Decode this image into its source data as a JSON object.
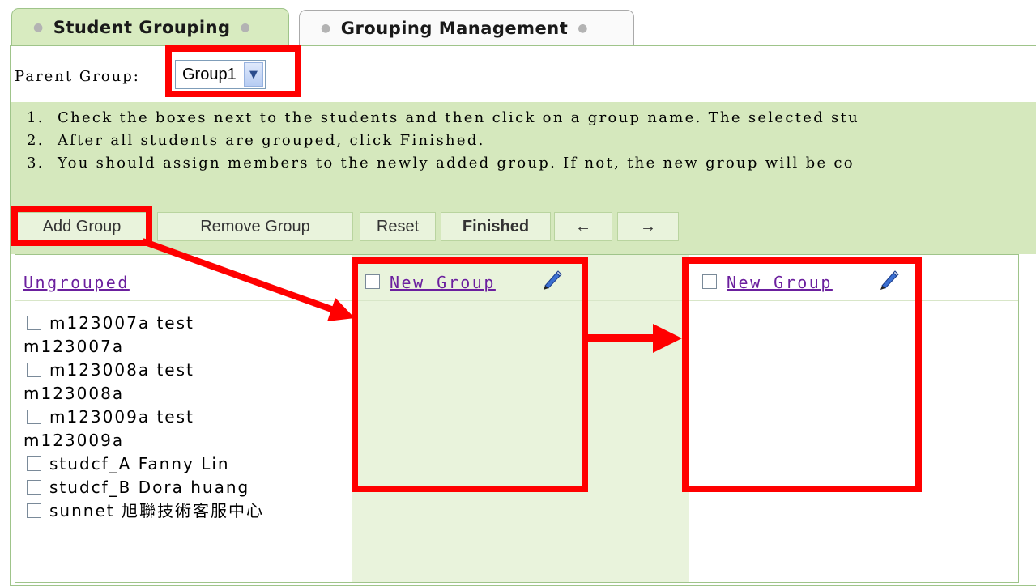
{
  "tabs": [
    {
      "label": "Student Grouping",
      "active": true
    },
    {
      "label": "Grouping Management",
      "active": false
    }
  ],
  "parent_group": {
    "label": "Parent Group:",
    "selected": "Group1"
  },
  "instructions": [
    {
      "num": "1.",
      "text": "Check the boxes next to the students and then click on a group name. The selected stu"
    },
    {
      "num": "2.",
      "text": "After all students are grouped, click Finished."
    },
    {
      "num": "3.",
      "text": "You should assign members to the newly added group. If not, the new group will be co"
    }
  ],
  "toolbar": {
    "add_group": "Add Group",
    "remove_group": "Remove Group",
    "reset": "Reset",
    "finished": "Finished",
    "prev": "←",
    "next": "→"
  },
  "ungrouped": {
    "title": "Ungrouped",
    "students": [
      {
        "id": "m123007a",
        "name": "test",
        "wrap": "m123007a"
      },
      {
        "id": "m123008a",
        "name": "test",
        "wrap": "m123008a"
      },
      {
        "id": "m123009a",
        "name": "test",
        "wrap": "m123009a"
      },
      {
        "id": "studcf_A",
        "name": "Fanny Lin",
        "wrap": ""
      },
      {
        "id": "studcf_B",
        "name": "Dora huang",
        "wrap": ""
      },
      {
        "id": "sunnet",
        "name": "旭聯技術客服中心",
        "wrap": ""
      }
    ]
  },
  "groups": [
    {
      "title": "New Group"
    },
    {
      "title": "New Group"
    }
  ],
  "colors": {
    "tab_active": "#d8ebc0",
    "instruction_bg": "#d5e8bd",
    "button_bg": "#e9f3dc",
    "link": "#6b1f9e",
    "annotation": "#ff0000"
  },
  "icons": {
    "edit": "pencil-icon",
    "dropdown": "chevron-down-icon"
  }
}
